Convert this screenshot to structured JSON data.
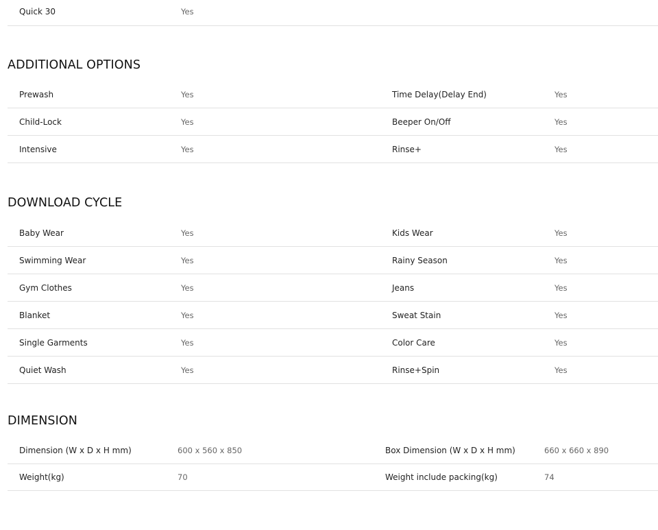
{
  "top_spec": {
    "label": "Quick 30",
    "value": "Yes"
  },
  "additional_options": {
    "title": "ADDITIONAL OPTIONS",
    "rows": [
      {
        "left_label": "Prewash",
        "left_value": "Yes",
        "right_label": "Time Delay(Delay End)",
        "right_value": "Yes"
      },
      {
        "left_label": "Child-Lock",
        "left_value": "Yes",
        "right_label": "Beeper On/Off",
        "right_value": "Yes"
      },
      {
        "left_label": "Intensive",
        "left_value": "Yes",
        "right_label": "Rinse+",
        "right_value": "Yes"
      }
    ]
  },
  "download_cycle": {
    "title": "DOWNLOAD CYCLE",
    "rows": [
      {
        "left_label": "Baby Wear",
        "left_value": "Yes",
        "right_label": "Kids Wear",
        "right_value": "Yes"
      },
      {
        "left_label": "Swimming Wear",
        "left_value": "Yes",
        "right_label": "Rainy Season",
        "right_value": "Yes"
      },
      {
        "left_label": "Gym Clothes",
        "left_value": "Yes",
        "right_label": "Jeans",
        "right_value": "Yes"
      },
      {
        "left_label": "Blanket",
        "left_value": "Yes",
        "right_label": "Sweat Stain",
        "right_value": "Yes"
      },
      {
        "left_label": "Single Garments",
        "left_value": "Yes",
        "right_label": "Color Care",
        "right_value": "Yes"
      },
      {
        "left_label": "Quiet Wash",
        "left_value": "Yes",
        "right_label": "Rinse+Spin",
        "right_value": "Yes"
      }
    ]
  },
  "dimension": {
    "title": "DIMENSION",
    "rows": [
      {
        "left_label": "Dimension (W x D x H mm)",
        "left_value": "600 x 560 x 850",
        "right_label": "Box Dimension (W x D x H mm)",
        "right_value": "660 x 660 x 890"
      },
      {
        "left_label": "Weight(kg)",
        "left_value": "70",
        "right_label": "Weight include packing(kg)",
        "right_value": "74"
      }
    ]
  }
}
